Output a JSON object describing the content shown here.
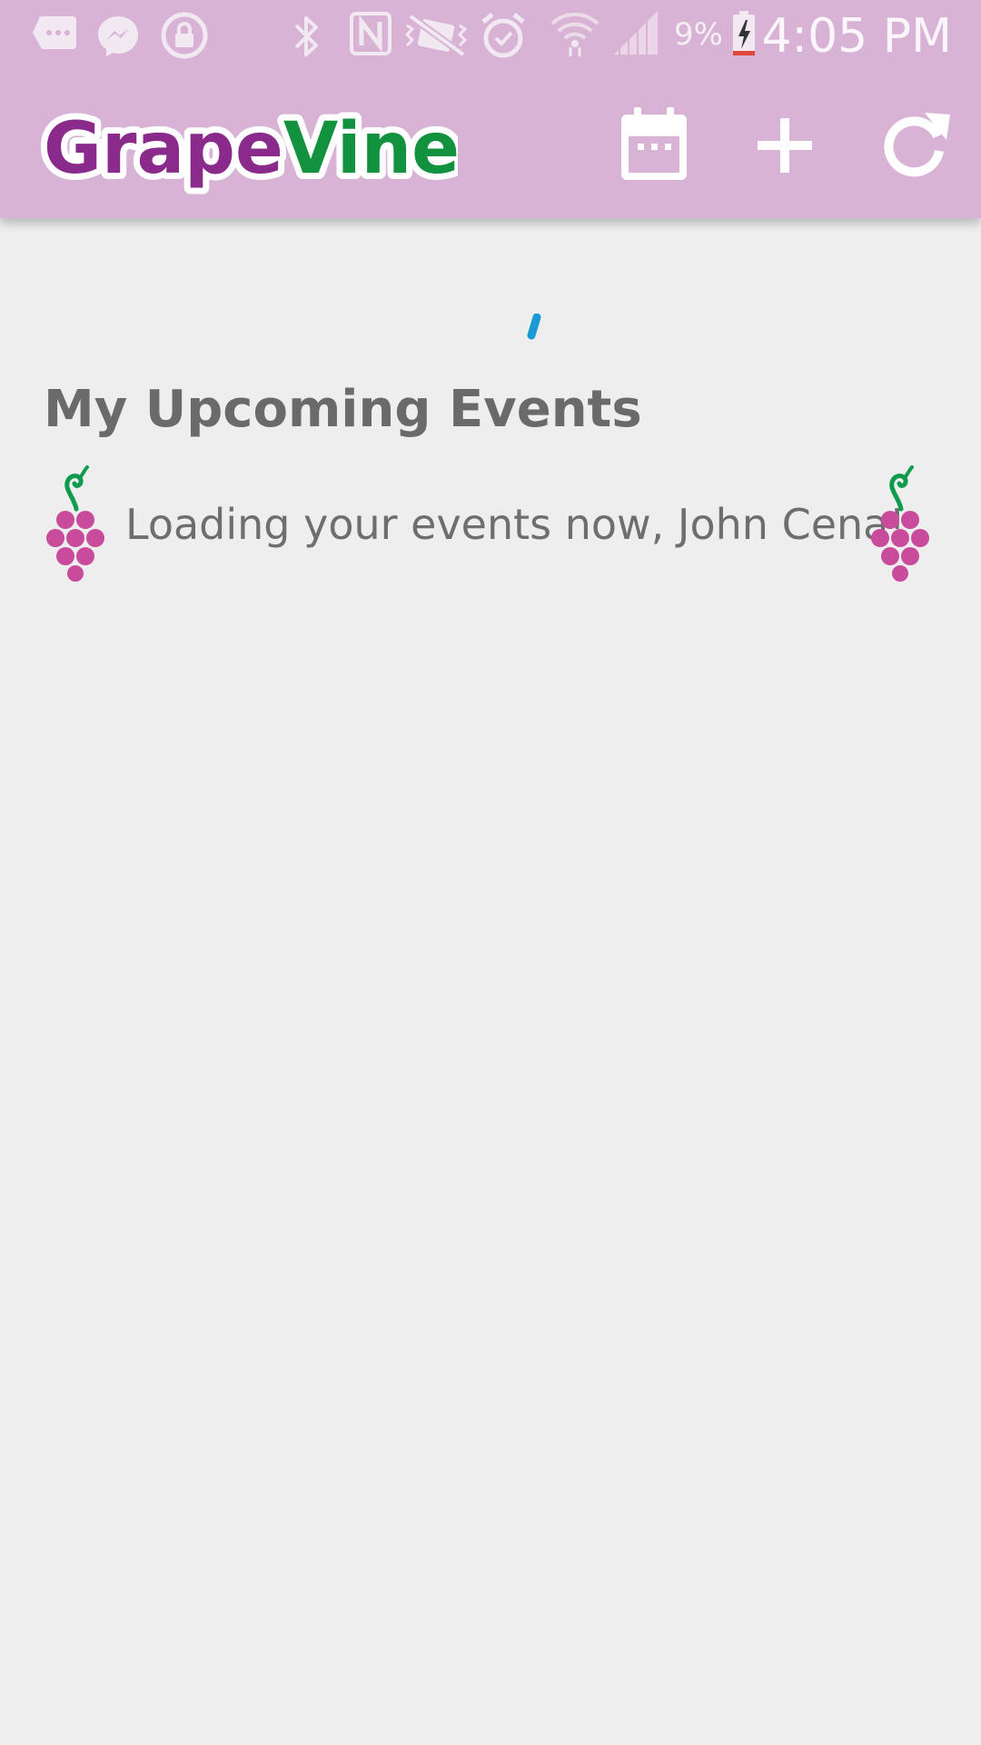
{
  "status_bar": {
    "battery_percent": "9%",
    "time": "4:05 PM",
    "icons": [
      "sms-icon",
      "messenger-icon",
      "lock-icon",
      "bluetooth-icon",
      "nfc-icon",
      "vibrate-icon",
      "alarm-icon",
      "wifi-icon",
      "signal-icon",
      "battery-charging-icon"
    ]
  },
  "app_bar": {
    "logo_text_part1": "Grape",
    "logo_text_part2": "Vine",
    "actions": [
      "calendar-icon",
      "add-icon",
      "refresh-icon"
    ],
    "background": "#d8b3d5"
  },
  "main": {
    "section_title": "My Upcoming Events",
    "loading_message": "Loading your events now, John Cena!",
    "colors": {
      "logo_purple": "#8a2b8c",
      "logo_green": "#12913f",
      "grape_pink": "#c94b9c",
      "stem_green": "#0f9b4e",
      "spinner_blue": "#1a9ad6"
    }
  }
}
